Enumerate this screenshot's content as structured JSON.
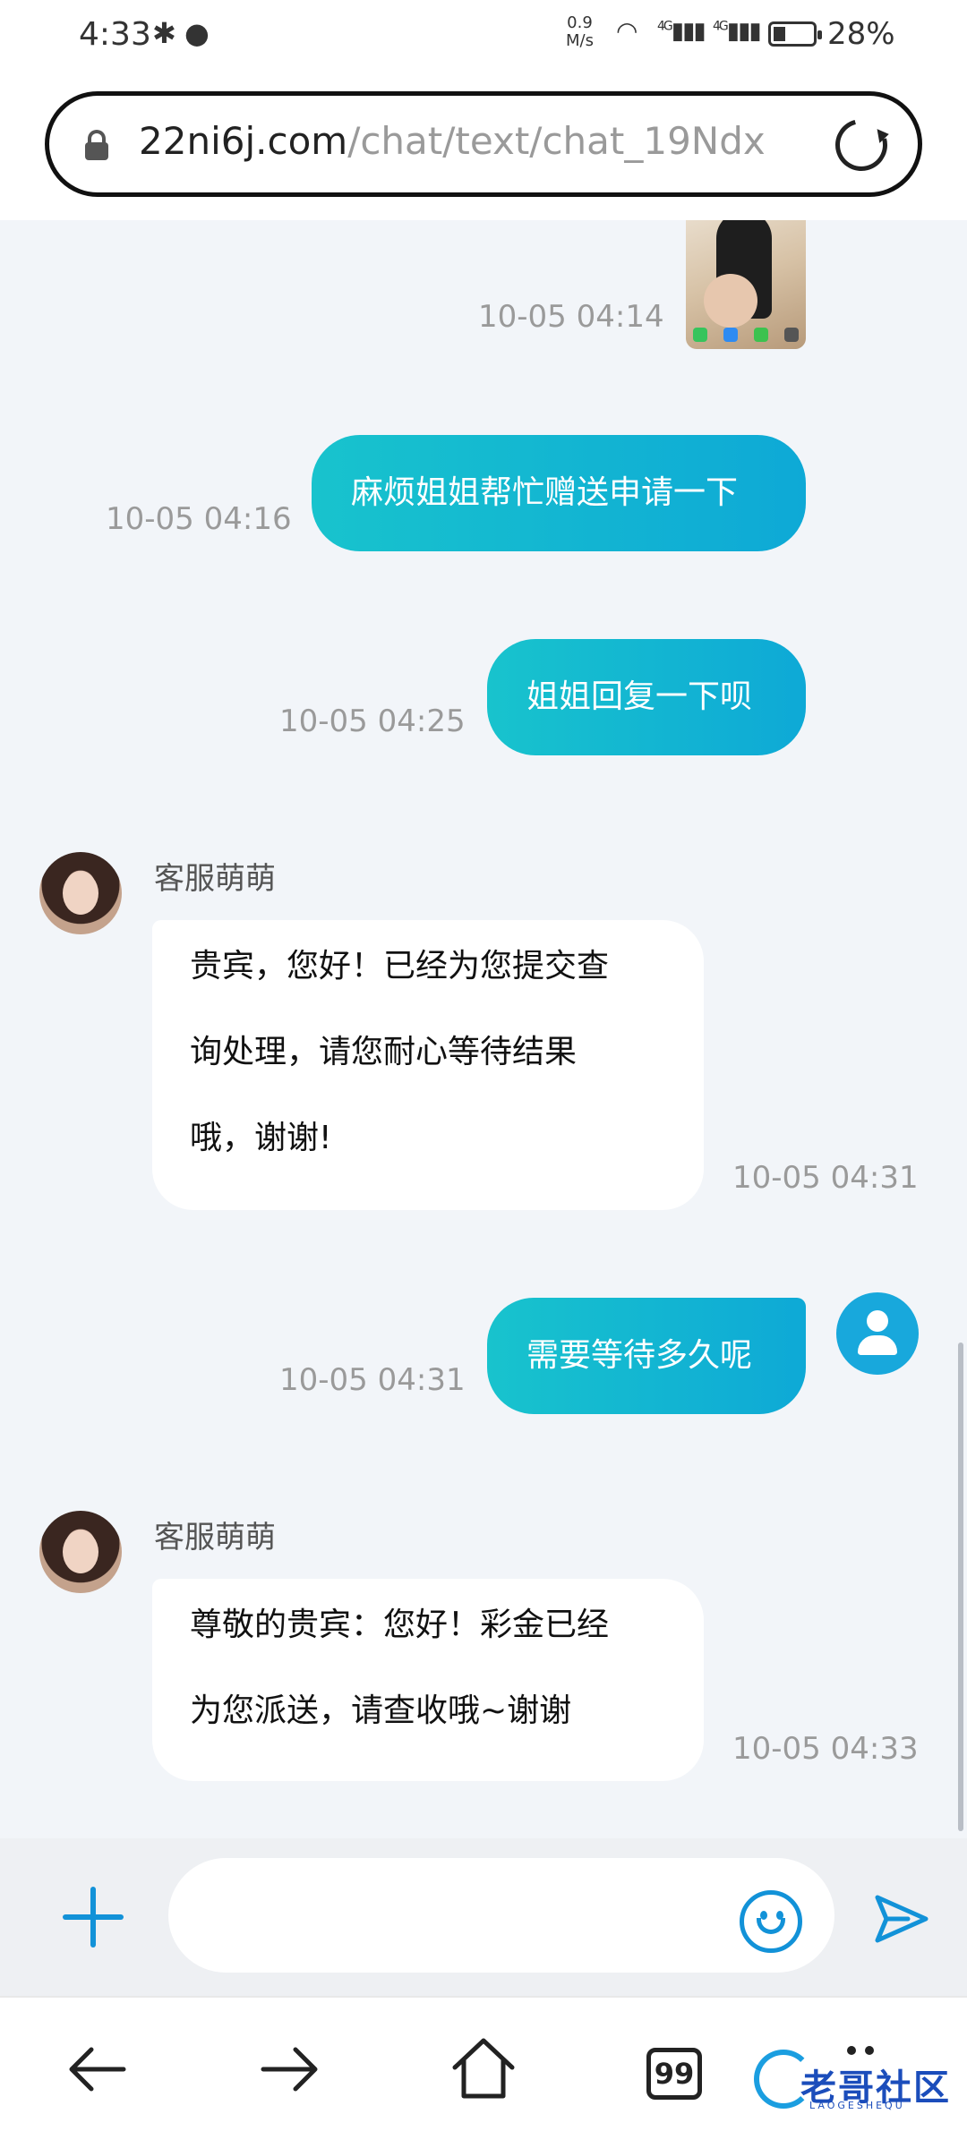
{
  "status_bar": {
    "time": "4:33",
    "net_speed_value": "0.9",
    "net_speed_unit": "M/s",
    "network_1": "4G",
    "network_2": "4G",
    "battery": "28%"
  },
  "browser": {
    "url_domain": "22ni6j.com",
    "url_path": "/chat/text/chat_19Ndx"
  },
  "chat": {
    "messages": [
      {
        "type": "image",
        "time": "10-05 04:14"
      },
      {
        "type": "outgoing",
        "text": "麻烦姐姐帮忙赠送申请一下",
        "time": "10-05 04:16"
      },
      {
        "type": "outgoing",
        "text": "姐姐回复一下呗",
        "time": "10-05 04:25"
      },
      {
        "type": "incoming",
        "sender": "客服萌萌",
        "lines": [
          "贵宾，您好！已经为您提交查",
          "询处理，请您耐心等待结果",
          "哦，谢谢!"
        ],
        "time": "10-05 04:31"
      },
      {
        "type": "outgoing",
        "text": "需要等待多久呢",
        "time": "10-05 04:31"
      },
      {
        "type": "incoming",
        "sender": "客服萌萌",
        "lines": [
          "尊敬的贵宾：您好！彩金已经",
          "为您派送，请查收哦~谢谢"
        ],
        "time": "10-05 04:33"
      }
    ]
  },
  "input": {
    "placeholder": ""
  },
  "bottom_nav": {
    "tabs_count": "99",
    "watermark": "老哥社区",
    "watermark_sub": "LAOGESHEQU"
  },
  "colors": {
    "accent": "#1292d8",
    "bubble_start": "#18c3cd",
    "bubble_end": "#0ea9d6",
    "background": "#f2f5f9"
  }
}
